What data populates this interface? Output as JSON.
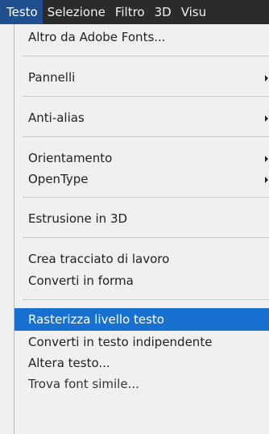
{
  "menubar": {
    "items": [
      "Testo",
      "Selezione",
      "Filtro",
      "3D",
      "Visu"
    ]
  },
  "menu": {
    "items": [
      {
        "label": "Altro da Adobe Fonts..."
      },
      {
        "label": "Pannelli",
        "submenu": true
      },
      {
        "label": "Anti-alias",
        "submenu": true
      },
      {
        "label": "Orientamento",
        "submenu": true
      },
      {
        "label": "OpenType",
        "submenu": true
      },
      {
        "label": "Estrusione in 3D"
      },
      {
        "label": "Crea tracciato di lavoro"
      },
      {
        "label": "Converti in forma"
      },
      {
        "label": "Rasterizza livello testo",
        "highlighted": true
      },
      {
        "label": "Converti in testo indipendente"
      },
      {
        "label": "Altera testo..."
      },
      {
        "label": "Trova font simile..."
      }
    ]
  },
  "colors": {
    "menubar_bg": "#2b2b2b",
    "menubar_active": "#1f4f8f",
    "menu_bg": "#f0f0f0",
    "highlight": "#1871d1"
  }
}
